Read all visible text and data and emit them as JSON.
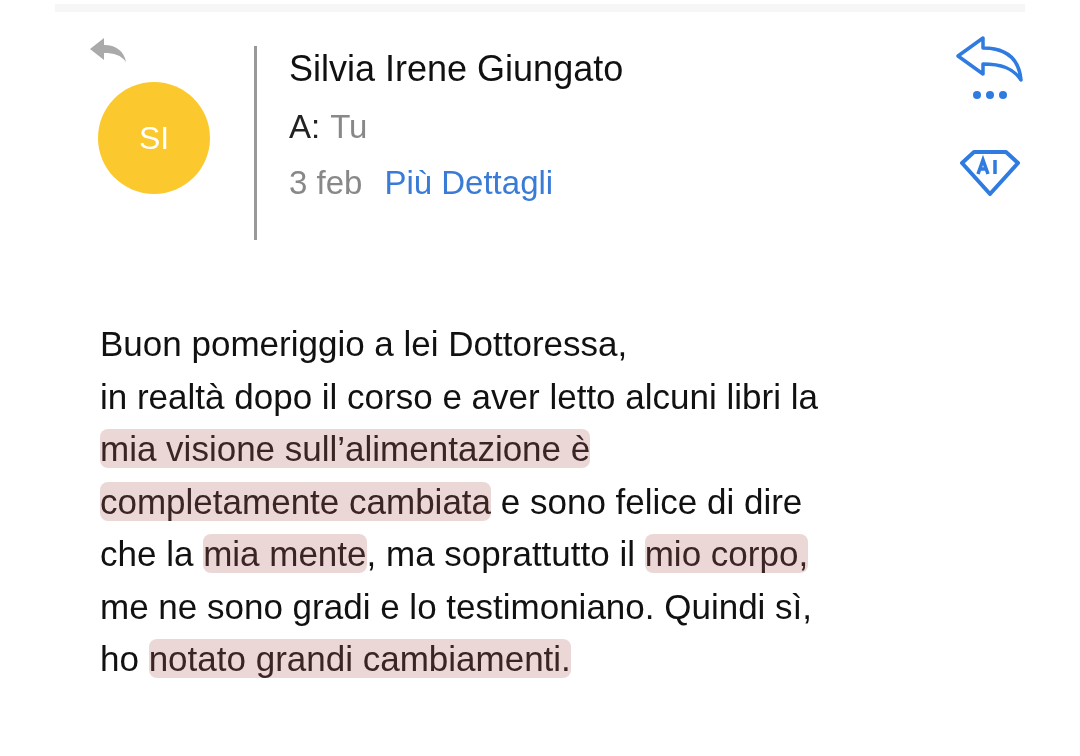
{
  "header": {
    "avatar": {
      "initials": "SI",
      "color": "#fbc92e"
    },
    "sender": "Silvia Irene Giungato",
    "to_label": "A:",
    "to_value": "Tu",
    "date": "3 feb",
    "details_link": "Più Dettagli"
  },
  "body": {
    "lines": [
      [
        {
          "text": "Buon pomeriggio a lei Dottoressa,",
          "highlighted": false
        }
      ],
      [
        {
          "text": "in realtà dopo il corso e aver letto alcuni libri la",
          "highlighted": false
        }
      ],
      [
        {
          "text": "mia visione sull’alimentazione è",
          "highlighted": true
        }
      ],
      [
        {
          "text": "completamente cambiata",
          "highlighted": true
        },
        {
          "text": " e sono felice di dire",
          "highlighted": false
        }
      ],
      [
        {
          "text": "che la ",
          "highlighted": false
        },
        {
          "text": "mia mente",
          "highlighted": true
        },
        {
          "text": ", ma soprattutto il ",
          "highlighted": false
        },
        {
          "text": "mio corpo,",
          "highlighted": true
        }
      ],
      [
        {
          "text": "me ne sono gradi e lo testimoniano. Quindi sì,",
          "highlighted": false
        }
      ],
      [
        {
          "text": "ho ",
          "highlighted": false
        },
        {
          "text": "notato grandi cambiamenti.",
          "highlighted": true
        }
      ]
    ]
  }
}
